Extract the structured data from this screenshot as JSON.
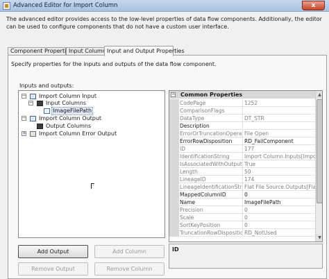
{
  "window": {
    "title": "Advanced Editor for Import Column",
    "close_glyph": "x"
  },
  "description": "The advanced editor provides access to the low-level properties of data flow components. Additionally, the editor can be used to configure components that do not have a custom user interface.",
  "tabs": [
    {
      "label": "Component Properties"
    },
    {
      "label": "Input Columns"
    },
    {
      "label": "Input and Output Properties"
    }
  ],
  "panel": {
    "description": "Specify properties for the inputs and outputs of the data flow component.",
    "io_label": "Inputs and outputs:"
  },
  "tree": [
    {
      "label": "Import Column Input",
      "expander": "−"
    },
    {
      "label": "Input Columns",
      "expander": "−"
    },
    {
      "label": "ImageFilePath"
    },
    {
      "label": "Import Column Output",
      "expander": "−"
    },
    {
      "label": "Output Columns"
    },
    {
      "label": "Import Column Error Output",
      "expander": "+"
    }
  ],
  "properties": {
    "category": "Common Properties",
    "category_toggle": "−",
    "rows": [
      {
        "name": "CodePage",
        "value": "1252"
      },
      {
        "name": "ComparisonFlags",
        "value": ""
      },
      {
        "name": "DataType",
        "value": "DT_STR"
      },
      {
        "name": "Description",
        "value": ""
      },
      {
        "name": "ErrorOrTruncationOperation",
        "value": "File Open"
      },
      {
        "name": "ErrorRowDisposition",
        "value": "RD_FailComponent"
      },
      {
        "name": "ID",
        "value": "177"
      },
      {
        "name": "IdentificationString",
        "value": "Import Column.Inputs[Import C"
      },
      {
        "name": "IsAssociatedWithOutputColumn",
        "value": "True"
      },
      {
        "name": "Length",
        "value": "50"
      },
      {
        "name": "LineageID",
        "value": "174"
      },
      {
        "name": "LineageIdentificationString",
        "value": "Flat File Source.Outputs[Flat File"
      },
      {
        "name": "MappedColumnID",
        "value": "0"
      },
      {
        "name": "Name",
        "value": "ImageFilePath"
      },
      {
        "name": "Precision",
        "value": "0"
      },
      {
        "name": "Scale",
        "value": "0"
      },
      {
        "name": "SortKeyPosition",
        "value": "0"
      },
      {
        "name": "TruncationRowDisposition",
        "value": "RD_NotUsed"
      }
    ],
    "description_title": "ID"
  },
  "buttons": {
    "add_output": "Add Output",
    "add_column": "Add Column",
    "remove_output": "Remove Output",
    "remove_column": "Remove Column"
  }
}
